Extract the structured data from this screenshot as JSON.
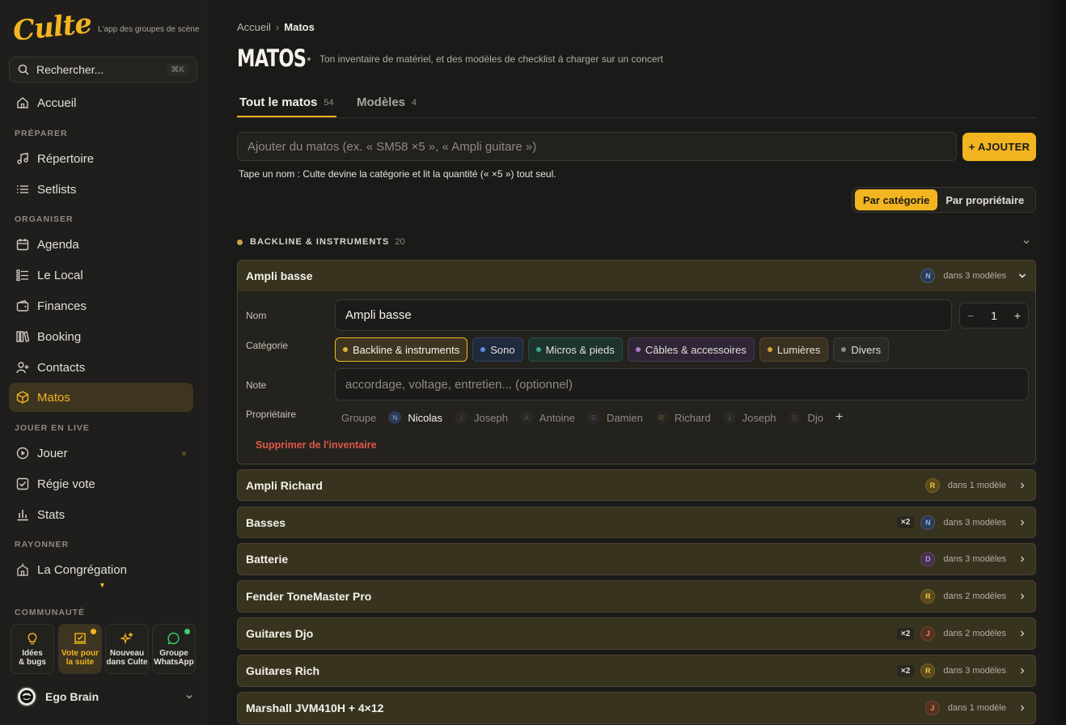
{
  "brand": {
    "logo": "Culte",
    "tagline": "L'app des groupes de scène"
  },
  "search": {
    "placeholder": "Rechercher...",
    "shortcut": "⌘K"
  },
  "nav": {
    "home": "Accueil",
    "section_prepare": "PRÉPARER",
    "repertoire": "Répertoire",
    "setlists": "Setlists",
    "section_organise": "ORGANISER",
    "agenda": "Agenda",
    "local": "Le Local",
    "finances": "Finances",
    "booking": "Booking",
    "contacts": "Contacts",
    "matos": "Matos",
    "section_live": "JOUER EN LIVE",
    "play": "Jouer",
    "vote": "Régie vote",
    "stats": "Stats",
    "section_shine": "RAYONNER",
    "congregation": "La Congrégation",
    "section_community": "COMMUNAUTÉ"
  },
  "community": [
    {
      "icon": "lightbulb-icon",
      "l1": "Idées",
      "l2": "& bugs"
    },
    {
      "icon": "vote-icon",
      "l1": "Vote pour",
      "l2": "la suite"
    },
    {
      "icon": "sparkles-icon",
      "l1": "Nouveau",
      "l2": "dans Culte"
    },
    {
      "icon": "whatsapp-icon",
      "l1": "Groupe",
      "l2": "WhatsApp"
    }
  ],
  "user": {
    "name": "Ego Brain"
  },
  "breadcrumb": {
    "home": "Accueil",
    "current": "Matos"
  },
  "page": {
    "title": "MATOS",
    "description": "Ton inventaire de matériel, et des modèles de checklist à charger sur un concert"
  },
  "tabs": [
    {
      "label": "Tout le matos",
      "count": "54"
    },
    {
      "label": "Modèles",
      "count": "4"
    }
  ],
  "add": {
    "placeholder": "Ajouter du matos (ex. « SM58 ×5 », « Ampli guitare »)",
    "button": "+ AJOUTER",
    "hint": "Tape un nom : Culte devine la catégorie et lit la quantité (« ×5 ») tout seul."
  },
  "grouping": {
    "by_category": "Par catégorie",
    "by_owner": "Par propriétaire"
  },
  "category": {
    "name": "BACKLINE & INSTRUMENTS",
    "count": "20"
  },
  "expanded": {
    "name": "Ampli basse",
    "owner_initial": "N",
    "models": "dans 3 modèles",
    "label_name": "Nom",
    "name_value": "Ampli basse",
    "quantity": "1",
    "minus": "−",
    "plus": "+",
    "label_category": "Catégorie",
    "categories": [
      {
        "label": "Backline & instruments",
        "color": "#e0b43a"
      },
      {
        "label": "Sono",
        "color": "#5a8fe0"
      },
      {
        "label": "Micros & pieds",
        "color": "#3aa890"
      },
      {
        "label": "Câbles & accessoires",
        "color": "#b07ad0"
      },
      {
        "label": "Lumières",
        "color": "#d8a23a"
      },
      {
        "label": "Divers",
        "color": "#8e8a82"
      }
    ],
    "label_note": "Note",
    "note_placeholder": "accordage, voltage, entretien... (optionnel)",
    "label_owner": "Propriétaire",
    "owners": [
      {
        "initial": "",
        "name": "Groupe"
      },
      {
        "initial": "N",
        "name": "Nicolas"
      },
      {
        "initial": "J",
        "name": "Joseph"
      },
      {
        "initial": "A",
        "name": "Antoine"
      },
      {
        "initial": "D",
        "name": "Damien"
      },
      {
        "initial": "R",
        "name": "Richard"
      },
      {
        "initial": "J",
        "name": "Joseph"
      },
      {
        "initial": "D",
        "name": "Djo"
      }
    ],
    "owner_add": "+",
    "delete": "Supprimer de l'inventaire"
  },
  "items": [
    {
      "name": "Ampli Richard",
      "qty": "",
      "initial": "R",
      "models": "dans 1 modèle"
    },
    {
      "name": "Basses",
      "qty": "×2",
      "initial": "N",
      "models": "dans 3 modèles"
    },
    {
      "name": "Batterie",
      "qty": "",
      "initial": "D",
      "models": "dans 3 modèles"
    },
    {
      "name": "Fender ToneMaster Pro",
      "qty": "",
      "initial": "R",
      "models": "dans 2 modèles"
    },
    {
      "name": "Guitares Djo",
      "qty": "×2",
      "initial": "J",
      "models": "dans 2 modèles"
    },
    {
      "name": "Guitares Rich",
      "qty": "×2",
      "initial": "R",
      "models": "dans 3 modèles"
    },
    {
      "name": "Marshall JVM410H + 4×12",
      "qty": "",
      "initial": "J",
      "models": "dans 1 modèle"
    }
  ]
}
